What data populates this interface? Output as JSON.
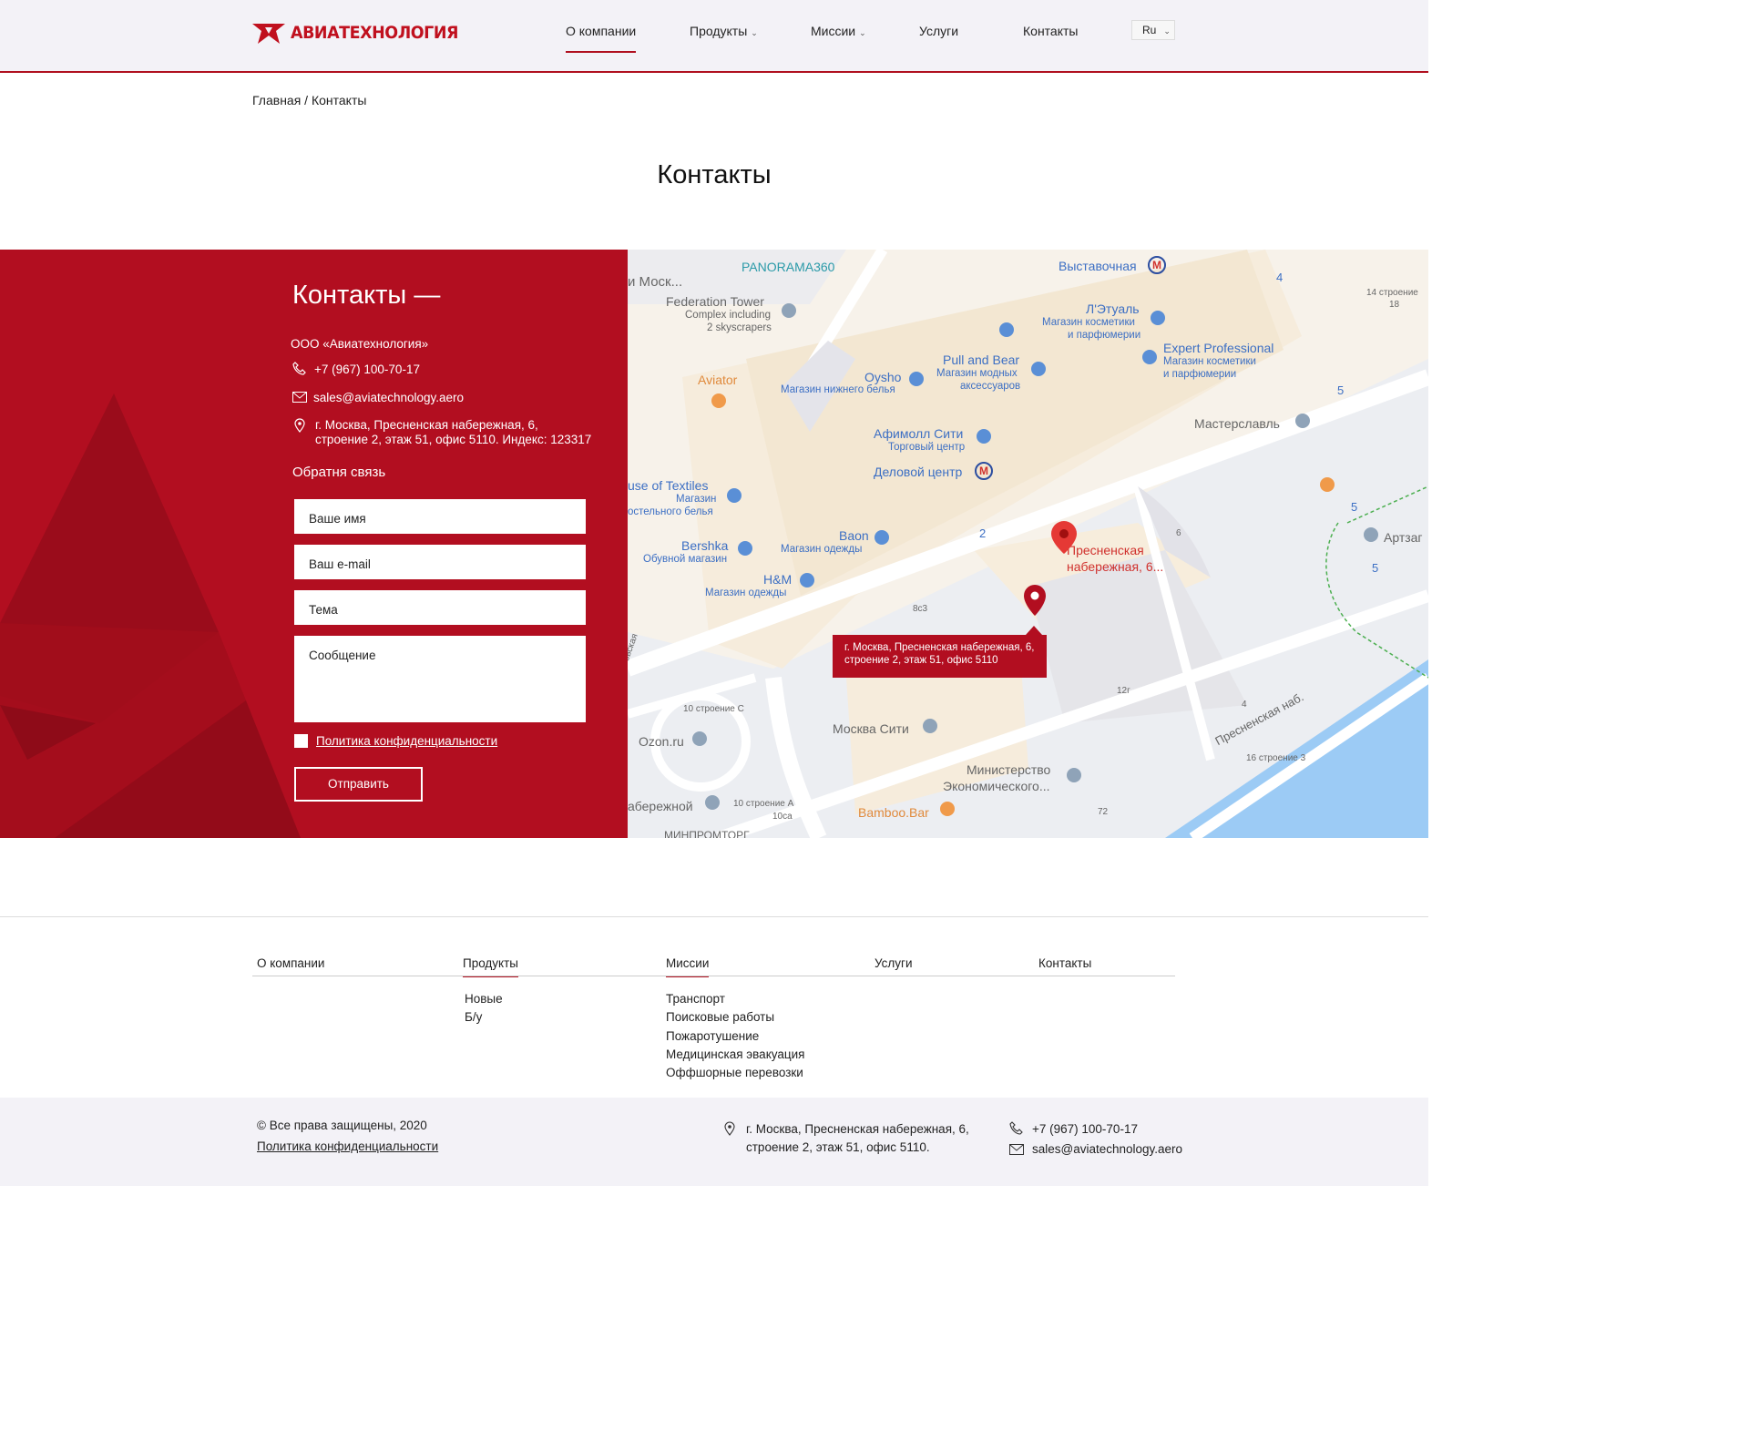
{
  "header": {
    "logo_text": "АВИАТЕХНОЛОГИЯ",
    "nav": [
      "О компании",
      "Продукты",
      "Миссии",
      "Услуги",
      "Контакты"
    ],
    "lang": "Ru"
  },
  "breadcrumb": "Главная / Контакты",
  "page_title": "Контакты",
  "contacts": {
    "title": "Контакты —",
    "company": "ООО «Авиатехнология»",
    "phone": "+7 (967) 100-70-17",
    "email": "sales@aviatechnology.aero",
    "address_line1": "г. Москва, Пресненская набережная, 6,",
    "address_line2": "строение 2, этаж 51, офис 5110. Индекс: 123317"
  },
  "form": {
    "title": "Обратня связь",
    "name_placeholder": "Ваше имя",
    "email_placeholder": "Ваш e-mail",
    "subject_placeholder": "Тема",
    "message_placeholder": "Сообщение",
    "policy_label": "Политика конфиденциальности",
    "submit_label": "Отправить"
  },
  "map": {
    "tooltip_line1": "г. Москва, Пресненская набережная, 6,",
    "tooltip_line2": "строение 2, этаж 51, офис 5110",
    "labels": {
      "moscow_cut": "и Моск...",
      "panorama": "PANORAMA360",
      "vystavochnaya": "Выставочная",
      "federation1": "Federation Tower",
      "federation2": "Complex including",
      "federation3": "2 skyscrapers",
      "letual": "Л'Этуаль",
      "letual_sub1": "Магазин косметики",
      "letual_sub2": "и парфюмерии",
      "expert": "Expert Professional",
      "expert_sub1": "Магазин косметики",
      "expert_sub2": "и парфюмерии",
      "aviator": "Aviator",
      "oysho": "Oysho",
      "oysho_sub": "Магазин нижнего белья",
      "pullbear": "Pull and Bear",
      "pullbear_sub1": "Магазин модных",
      "pullbear_sub2": "аксессуаров",
      "afimall": "Афимолл Сити",
      "afimall_sub": "Торговый центр",
      "delovoy": "Деловой центр",
      "masterslavl": "Мастерславль",
      "textiles": "use of Textiles",
      "textiles_sub1": "Магазин",
      "textiles_sub2": "остельного белья",
      "bershka": "Bershka",
      "bershka_sub": "Обувной магазин",
      "baon": "Baon",
      "baon_sub": "Магазин одежды",
      "hm": "H&M",
      "hm_sub": "Магазин одежды",
      "presnenskaya1": "Пресненская",
      "presnenskaya2": "набережная, 6...",
      "artzag": "Артзаг",
      "moskva_city": "Москва Сити",
      "ozon": "Ozon.ru",
      "ministry1": "Министерство",
      "ministry2": "Экономического...",
      "naberezhnoy": "абережной",
      "bamboo": "Bamboo.Bar",
      "minpromtorg": "МИНПРОМТОРГ",
      "street": "Пресненская наб.",
      "testovskaya": "тестовская",
      "bld14": "14 строение",
      "bld14b": "18",
      "bld10c": "10 строение С",
      "bld10a": "10 строение А",
      "bld10ca": "10са",
      "bld16": "16 строение 3",
      "n4": "4",
      "n5a": "5",
      "n5b": "5",
      "n5c": "5",
      "n2": "2",
      "n6": "6",
      "n8c3": "8с3",
      "n12g": "12г",
      "n72": "72",
      "n4b": "4"
    }
  },
  "footer": {
    "nav": [
      "О компании",
      "Продукты",
      "Миссии",
      "Услуги",
      "Контакты"
    ],
    "products": [
      "Новые",
      "Б/у"
    ],
    "missions": [
      "Транспорт",
      "Поисковые работы",
      "Пожаротушение",
      "Медицинская эвакуация",
      "Оффшорные перевозки"
    ],
    "copyright": "© Все права защищены, 2020",
    "policy": "Политика конфиденциальности",
    "address_line1": "г. Москва, Пресненская набережная, 6,",
    "address_line2": "строение 2, этаж 51, офис 5110.",
    "phone": "+7 (967) 100-70-17",
    "email": "sales@aviatechnology.aero"
  },
  "colors": {
    "brand_red": "#b20e20",
    "map_blue": "#3c6fc4"
  }
}
